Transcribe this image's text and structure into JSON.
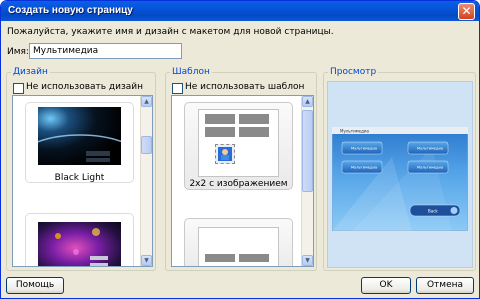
{
  "window": {
    "title": "Создать новую страницу",
    "close_glyph": "✕"
  },
  "hint": "Пожалуйста, укажите имя и дизайн с макетом для новой страницы.",
  "name": {
    "label": "Имя:",
    "value": "Мультимедиа"
  },
  "design": {
    "title": "Дизайн",
    "no_design_label": "Не использовать дизайн",
    "no_design_checked": false,
    "items": [
      {
        "label": "Black Light"
      }
    ]
  },
  "template": {
    "title": "Шаблон",
    "no_template_label": "Не использовать шаблон",
    "no_template_checked": false,
    "items": [
      {
        "label": "2x2 с изображением"
      }
    ]
  },
  "preview": {
    "title": "Просмотр",
    "window_title": "Мультимедиа",
    "buttons": [
      "Мультимедиа",
      "Мультимедиа",
      "Мультимедиа",
      "Мультимедиа"
    ],
    "back_label": "Back"
  },
  "footer": {
    "help_label": "Помощь",
    "ok_label": "OK",
    "cancel_label": "Отмена"
  },
  "colors": {
    "titlebar": "#0653d6",
    "group_title": "#0046d5",
    "preview_bg": "#cfe3f5"
  }
}
